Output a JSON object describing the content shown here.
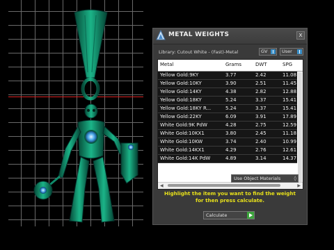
{
  "dialog": {
    "title": "METAL WEIGHTS",
    "close_label": "x",
    "library_label": "Library: Cutout White - (Fast)-Metal",
    "gv_label": "GV",
    "user_label": "User",
    "object_materials_label": "Use Object Materials",
    "hint_line1": "Highlight the item you want to find the weight",
    "hint_line2": "for then press calculate.",
    "calculate_label": "Calculate"
  },
  "table": {
    "columns": [
      "Metal",
      "Grams",
      "DWT",
      "SPG"
    ],
    "rows": [
      [
        "Yellow Gold:9KY",
        "3.77",
        "2.42",
        "11.08"
      ],
      [
        "Yellow Gold:10KY",
        "3.90",
        "2.51",
        "11.45"
      ],
      [
        "Yellow Gold:14KY",
        "4.38",
        "2.82",
        "12.88"
      ],
      [
        "Yellow Gold:18KY",
        "5.24",
        "3.37",
        "15.41"
      ],
      [
        "Yellow Gold:18KY R...",
        "5.24",
        "3.37",
        "15.41"
      ],
      [
        "Yellow Gold:22KY",
        "6.09",
        "3.91",
        "17.89"
      ],
      [
        "White Gold:9K PdW",
        "4.28",
        "2.75",
        "12.59"
      ],
      [
        "White Gold:10KX1",
        "3.80",
        "2.45",
        "11.18"
      ],
      [
        "White Gold:10KW",
        "3.74",
        "2.40",
        "10.99"
      ],
      [
        "White Gold:14KX1",
        "4.29",
        "2.76",
        "12.61"
      ],
      [
        "White Gold:14K PdW",
        "4.89",
        "3.14",
        "14.37"
      ]
    ]
  },
  "colors": {
    "hint_text": "#e8e11a",
    "model_green": "#0f8a6a",
    "axis_red": "#dd2222",
    "accent_blue": "#3a8fc8"
  },
  "icons": [
    "app-logo-icon",
    "close-icon",
    "dropdown-arrow-icon",
    "play-arrow-icon"
  ]
}
